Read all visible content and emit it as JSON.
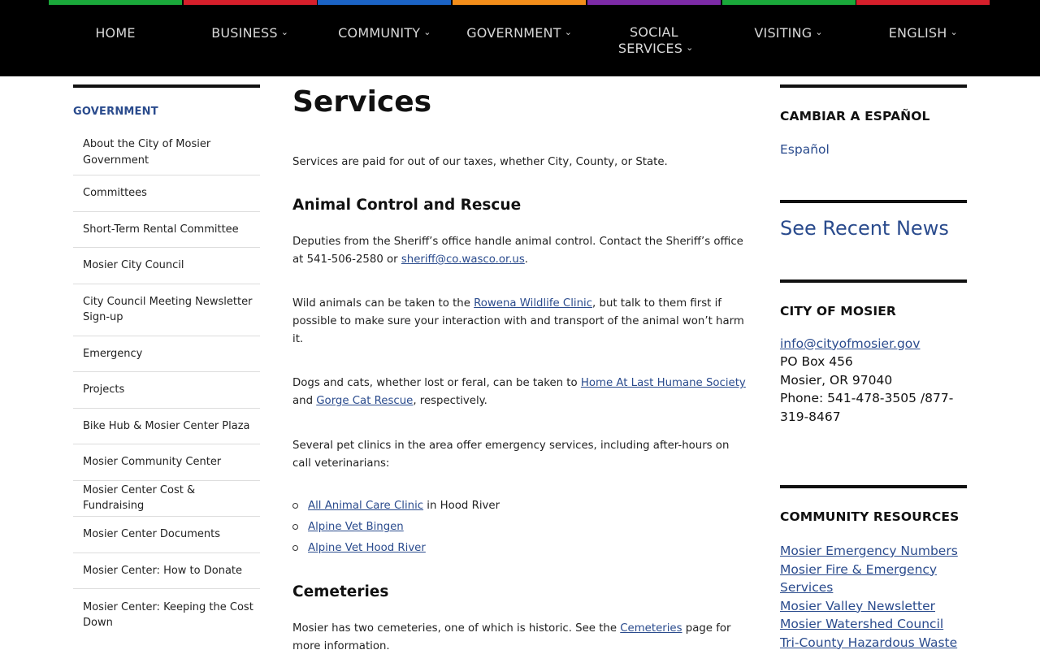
{
  "nav": {
    "items": [
      {
        "label": "HOME",
        "color": "#1aa83a",
        "dropdown": false
      },
      {
        "label": "BUSINESS",
        "color": "#d61f2b",
        "dropdown": true
      },
      {
        "label": "COMMUNITY",
        "color": "#1b63c5",
        "dropdown": true
      },
      {
        "label": "GOVERNMENT",
        "color": "#f28d1a",
        "dropdown": true
      },
      {
        "label": "SOCIAL SERVICES",
        "color": "#7c2aa6",
        "dropdown": true
      },
      {
        "label": "VISITING",
        "color": "#1aa83a",
        "dropdown": true
      },
      {
        "label": "ENGLISH",
        "color": "#d61f2b",
        "dropdown": true
      }
    ]
  },
  "left_sidebar": {
    "title": "GOVERNMENT",
    "items": [
      "About the City of Mosier Government",
      "Committees",
      "Short-Term Rental Committee",
      "Mosier City Council",
      "City Council Meeting Newsletter Sign-up",
      "Emergency",
      "Projects",
      "Bike Hub & Mosier Center Plaza",
      "Mosier Community Center",
      "Mosier Center Cost & Fundraising",
      "Mosier Center Documents",
      "Mosier Center: How to Donate",
      "Mosier Center: Keeping the Cost Down"
    ]
  },
  "main": {
    "title": "Services",
    "intro": "Services are paid for out of our taxes, whether City, County, or State.",
    "animal": {
      "heading": "Animal Control and Rescue",
      "p1_text": "Deputies from the Sheriff’s office handle animal control. Contact the Sheriff’s office at 541-506-2580 or ",
      "p1_link": "sheriff@co.wasco.or.us",
      "p1_end": ".",
      "p2_text": "Wild animals can be taken to the ",
      "p2_link": "Rowena Wildlife Clinic",
      "p2_end": ", but talk to them first if possible to make sure your interaction with and transport of the animal won’t harm it.",
      "p3_text": "Dogs and cats, whether lost or feral, can be taken to ",
      "p3_link1": "Home At Last Humane Society",
      "p3_mid": " and ",
      "p3_link2": "Gorge Cat Rescue",
      "p3_end": ", respectively.",
      "p4": "Several pet clinics in the area offer emergency services, including after-hours on call veterinarians:",
      "clinics": [
        {
          "link": "All Animal Care Clinic",
          "suffix": " in Hood River"
        },
        {
          "link": "Alpine Vet Bingen",
          "suffix": ""
        },
        {
          "link": "Alpine Vet Hood River",
          "suffix": ""
        }
      ]
    },
    "cemeteries": {
      "heading": "Cemeteries",
      "text": "Mosier has two cemeteries, one of which is historic. See the ",
      "link": "Cemeteries",
      "end": " page for more information."
    }
  },
  "right_sidebar": {
    "spanish_title": "CAMBIAR A ESPAÑOL",
    "spanish_link": "Español",
    "news_link": "See Recent News",
    "city_title": "CITY OF MOSIER",
    "email": "info@cityofmosier.gov",
    "po_box": "PO Box 456",
    "city_state": "Mosier, OR 97040",
    "phone": "Phone: 541-478-3505 /877-319-8467",
    "resources_title": "COMMUNITY RESOURCES",
    "resources": [
      "Mosier Emergency Numbers",
      "Mosier Fire & Emergency Services",
      "Mosier Valley Newsletter",
      "Mosier Watershed Council",
      "Tri-County Hazardous Waste &"
    ]
  },
  "colors": {
    "link": "#2a4b8d",
    "nav_bg": "#000000"
  }
}
